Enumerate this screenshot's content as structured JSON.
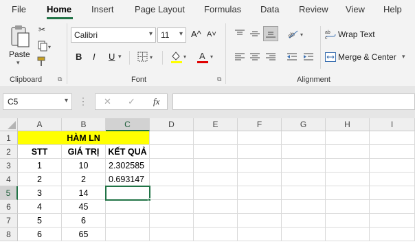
{
  "tabs": [
    "File",
    "Home",
    "Insert",
    "Page Layout",
    "Formulas",
    "Data",
    "Review",
    "View",
    "Help"
  ],
  "ribbon": {
    "clipboard": {
      "paste_label": "Paste",
      "group_label": "Clipboard"
    },
    "font": {
      "family": "Calibri",
      "size": "11",
      "bold": "B",
      "italic": "I",
      "underline": "U",
      "grow": "A^",
      "shrink": "A˅",
      "color_letter": "A",
      "group_label": "Font",
      "highlight_color": "#ffff00",
      "font_color": "#e00000"
    },
    "alignment": {
      "wrap_text": "Wrap Text",
      "merge_center": "Merge & Center",
      "group_label": "Alignment"
    }
  },
  "formula_bar": {
    "name_box": "C5",
    "cancel": "✕",
    "enter": "✓",
    "fx": "fx",
    "value": ""
  },
  "grid": {
    "columns": [
      "A",
      "B",
      "C",
      "D",
      "E",
      "F",
      "G",
      "H",
      "I"
    ],
    "rows": [
      "1",
      "2",
      "3",
      "4",
      "5",
      "6",
      "7",
      "8"
    ],
    "selected_cell": "C5",
    "title": "HÀM LN",
    "title_fill": "#ffff00",
    "headers": [
      "STT",
      "GIÁ TRỊ",
      "KẾT QUẢ"
    ],
    "data": [
      [
        "1",
        "10",
        "2.302585"
      ],
      [
        "2",
        "2",
        "0.693147"
      ],
      [
        "3",
        "14",
        ""
      ],
      [
        "4",
        "45",
        ""
      ],
      [
        "5",
        "6",
        ""
      ],
      [
        "6",
        "65",
        ""
      ]
    ]
  }
}
